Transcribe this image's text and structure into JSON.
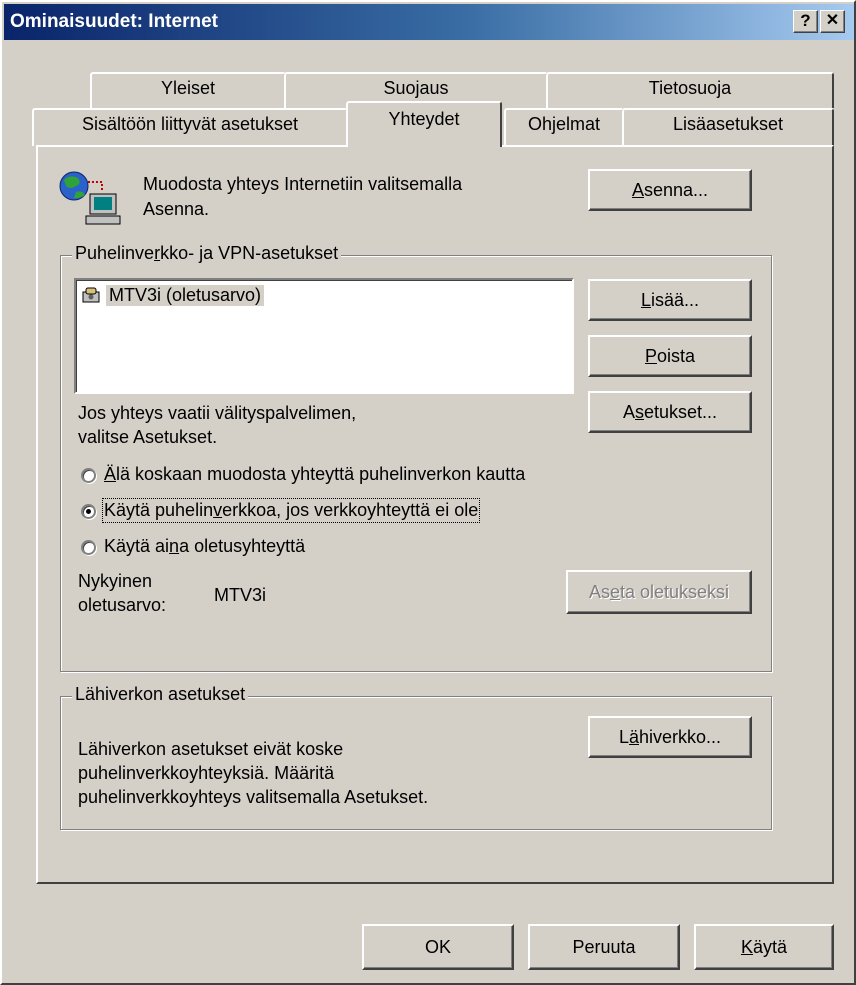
{
  "window": {
    "title": "Ominaisuudet: Internet",
    "help_button": "?",
    "close_button": "✕"
  },
  "tabs": {
    "row1": [
      "Yleiset",
      "Suojaus",
      "Tietosuoja"
    ],
    "row2": [
      "Sisältöön liittyvät asetukset",
      "Yhteydet",
      "Ohjelmat",
      "Lisäasetukset"
    ],
    "active": "Yhteydet"
  },
  "setup": {
    "text_line1": "Muodosta yhteys Internetiin valitsemalla",
    "text_line2": "Asenna.",
    "button": {
      "underline": "A",
      "rest": "senna..."
    }
  },
  "dialup_group": {
    "label_pre": "Puhelinve",
    "label_underline": "r",
    "label_post": "kko- ja VPN-asetukset",
    "list_items": [
      "MTV3i (oletusarvo)"
    ],
    "add_button": {
      "underline": "L",
      "rest": "isää..."
    },
    "remove_button": {
      "underline": "P",
      "rest": "oista"
    },
    "settings_button": {
      "pre": "A",
      "underline": "s",
      "rest": "etukset..."
    },
    "proxy_line1": "Jos yhteys vaatii välityspalvelimen,",
    "proxy_line2": "valitse Asetukset.",
    "radio_options": [
      {
        "pre": "",
        "underline": "Ä",
        "post": "lä koskaan muodosta yhteyttä puhelinverkon kautta",
        "selected": false
      },
      {
        "pre": "Käytä puhelin",
        "underline": "v",
        "post": "erkkoa, jos verkkoyhteyttä ei ole",
        "selected": true
      },
      {
        "pre": "Käytä ai",
        "underline": "n",
        "post": "a oletusyhteyttä",
        "selected": false
      }
    ],
    "current_label_line1": "Nykyinen",
    "current_label_line2": "oletusarvo:",
    "current_value": "MTV3i",
    "set_default_button": {
      "pre": "As",
      "underline": "e",
      "rest": "ta oletukseksi"
    }
  },
  "lan_group": {
    "label": "Lähiverkon asetukset",
    "text_line1": "Lähiverkon asetukset eivät koske",
    "text_line2": "puhelinverkkoyhteyksiä. Määritä",
    "text_line3": "puhelinverkkoyhteys valitsemalla Asetukset.",
    "button": {
      "pre": "L",
      "underline": "ä",
      "rest": "hiverkko..."
    }
  },
  "footer": {
    "ok": "OK",
    "cancel": "Peruuta",
    "apply": {
      "underline": "K",
      "rest": "äytä"
    }
  }
}
